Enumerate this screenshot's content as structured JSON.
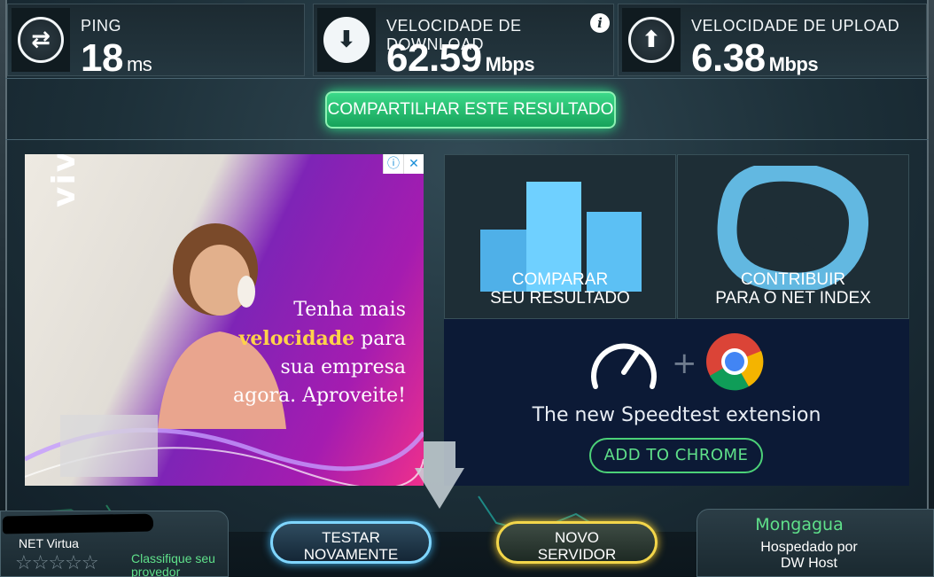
{
  "stats": {
    "ping": {
      "label": "PING",
      "value": "18",
      "unit": "ms",
      "icon": "swap-arrows-icon"
    },
    "download": {
      "label": "VELOCIDADE DE DOWNLOAD",
      "value": "62.59",
      "unit": "Mbps",
      "icon": "download-arrow-icon"
    },
    "upload": {
      "label": "VELOCIDADE DE UPLOAD",
      "value": "6.38",
      "unit": "Mbps",
      "icon": "upload-arrow-icon"
    }
  },
  "share_button": "COMPARTILHAR ESTE RESULTADO",
  "ad": {
    "brand": "vivo",
    "line1": "Tenha mais",
    "highlight": "velocidade",
    "line2_rest": " para",
    "line3": "sua empresa",
    "line4": "agora. Aproveite!",
    "info_glyph": "ⓘ",
    "close_glyph": "✕"
  },
  "tiles": {
    "compare": {
      "line1": "COMPARAR",
      "line2": "SEU RESULTADO"
    },
    "contribute": {
      "line1": "CONTRIBUIR",
      "line2": "PARA O NET INDEX"
    }
  },
  "extension": {
    "plus": "+",
    "title": "The new Speedtest extension",
    "button": "ADD TO CHROME"
  },
  "isp": {
    "name": "NET Virtua",
    "stars": "☆☆☆☆☆",
    "rate_label": "Classifique seu provedor"
  },
  "actions": {
    "test_again": {
      "line1": "TESTAR",
      "line2": "NOVAMENTE"
    },
    "new_server": {
      "line1": "NOVO",
      "line2": "SERVIDOR"
    }
  },
  "server": {
    "city": "Mongagua",
    "hosted_by": "Hospedado por",
    "host": "DW Host"
  },
  "colors": {
    "accent_green": "#3bd989",
    "text_green": "#5fe08a",
    "test_button_border": "#7fd6ff",
    "server_button_border": "#f3d64a",
    "ad_purple": "#7e24b6",
    "ad_pink": "#ef2f8c"
  }
}
